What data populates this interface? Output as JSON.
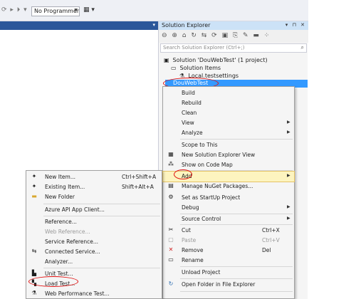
{
  "toolbar": {
    "nav_glyphs": "⟳ ▸ ⏵ ▾",
    "target": "No Programmer",
    "save_glyph": "▦ ▾"
  },
  "solution_explorer": {
    "title": "Solution Explorer",
    "title_controls": "▾ ⊓ ✕",
    "toolbar_glyphs": "⊖ ⊕ ⌂ ↻ ⇆ ⟳ ▣ ⎘ ✎ ▬ ⁘",
    "search_placeholder": "Search Solution Explorer (Ctrl+;)",
    "search_glyph": "⌕",
    "tree": [
      {
        "icon": "▣",
        "label": "Solution 'DouWebTest' (1 project)"
      },
      {
        "icon": "▭",
        "label": "Solution Items"
      },
      {
        "icon": "⚗",
        "label": "Local.testsettings"
      }
    ],
    "selected_project": "DouWebTest"
  },
  "project_menu": {
    "items": [
      {
        "icon": "",
        "label": "Build",
        "shortcut": "",
        "submenu": false
      },
      {
        "icon": "",
        "label": "Rebuild",
        "shortcut": "",
        "submenu": false
      },
      {
        "icon": "",
        "label": "Clean",
        "shortcut": "",
        "submenu": false
      },
      {
        "icon": "",
        "label": "View",
        "shortcut": "",
        "submenu": true
      },
      {
        "icon": "",
        "label": "Analyze",
        "shortcut": "",
        "submenu": true
      },
      {
        "icon": "",
        "label": "Scope to This",
        "shortcut": "",
        "submenu": false
      },
      {
        "icon": "▦",
        "label": "New Solution Explorer View",
        "shortcut": "",
        "submenu": false
      },
      {
        "icon": "⁂",
        "label": "Show on Code Map",
        "shortcut": "",
        "submenu": false
      },
      {
        "icon": "",
        "label": "Add",
        "shortcut": "",
        "submenu": true
      },
      {
        "icon": "▤",
        "label": "Manage NuGet Packages...",
        "shortcut": "",
        "submenu": false
      },
      {
        "icon": "⚙",
        "label": "Set as StartUp Project",
        "shortcut": "",
        "submenu": false
      },
      {
        "icon": "",
        "label": "Debug",
        "shortcut": "",
        "submenu": true
      },
      {
        "icon": "",
        "label": "Source Control",
        "shortcut": "",
        "submenu": true
      },
      {
        "icon": "✂",
        "label": "Cut",
        "shortcut": "Ctrl+X",
        "submenu": false
      },
      {
        "icon": "▢",
        "label": "Paste",
        "shortcut": "Ctrl+V",
        "submenu": false
      },
      {
        "icon": "✕",
        "label": "Remove",
        "shortcut": "Del",
        "submenu": false
      },
      {
        "icon": "▭",
        "label": "Rename",
        "shortcut": "",
        "submenu": false
      },
      {
        "icon": "",
        "label": "Unload Project",
        "shortcut": "",
        "submenu": false
      },
      {
        "icon": "↻",
        "label": "Open Folder in File Explorer",
        "shortcut": "",
        "submenu": false
      }
    ]
  },
  "add_menu": {
    "items": [
      {
        "icon": "✦",
        "label": "New Item...",
        "shortcut": "Ctrl+Shift+A"
      },
      {
        "icon": "✦",
        "label": "Existing Item...",
        "shortcut": "Shift+Alt+A"
      },
      {
        "icon": "▬",
        "label": "New Folder",
        "shortcut": ""
      },
      {
        "icon": "",
        "label": "Azure API App Client...",
        "shortcut": ""
      },
      {
        "icon": "",
        "label": "Reference...",
        "shortcut": ""
      },
      {
        "icon": "",
        "label": "Web Reference...",
        "shortcut": ""
      },
      {
        "icon": "",
        "label": "Service Reference...",
        "shortcut": ""
      },
      {
        "icon": "⇆",
        "label": "Connected Service...",
        "shortcut": ""
      },
      {
        "icon": "",
        "label": "Analyzer...",
        "shortcut": ""
      },
      {
        "icon": "▙",
        "label": "Unit Test...",
        "shortcut": ""
      },
      {
        "icon": "▚",
        "label": "Load Test...",
        "shortcut": ""
      },
      {
        "icon": "⚗",
        "label": "Web Performance Test...",
        "shortcut": ""
      }
    ]
  },
  "colors": {
    "accent": "#2b579a",
    "selection": "#3399ff",
    "annotation": "#e01010",
    "highlight": "#fdf4bf"
  }
}
